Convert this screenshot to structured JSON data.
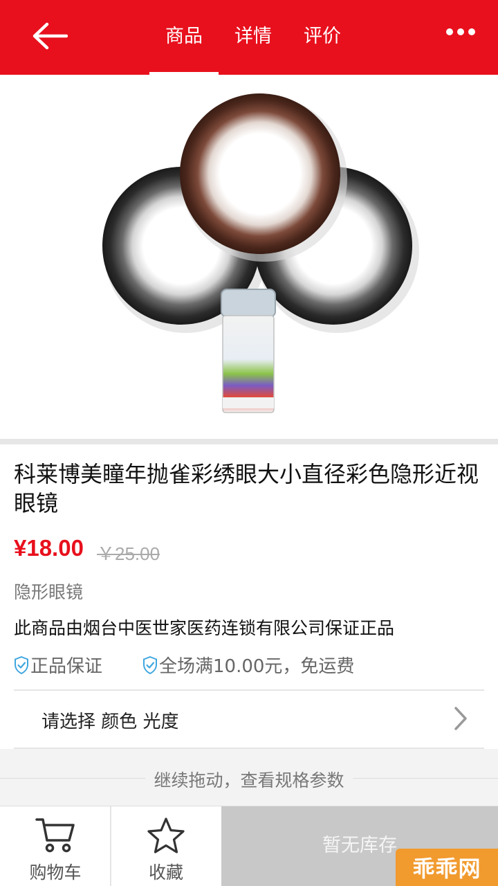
{
  "header": {
    "back_icon": "arrow-left-icon",
    "tabs": [
      {
        "label": "商品",
        "active": true
      },
      {
        "label": "详情",
        "active": false
      },
      {
        "label": "评价",
        "active": false
      }
    ],
    "more_icon": "more-dots-icon",
    "background_color": "#e8101d"
  },
  "product": {
    "image_alt": "contact-lens-product-image",
    "title": "科莱博美瞳年抛雀彩绣眼大小直径彩色隐形近视眼镜",
    "price": "¥18.00",
    "original_price": "￥25.00",
    "category": "隐形眼镜",
    "guarantee_text": "此商品由烟台中医世家医药连锁有限公司保证正品",
    "badges": [
      {
        "icon": "shield-check-icon",
        "label": "正品保证"
      },
      {
        "icon": "shield-check-icon",
        "label": "全场满10.00元，免运费"
      }
    ],
    "spec_select": "请选择 颜色 光度",
    "drag_hint": "继续拖动，查看规格参数"
  },
  "bottom_bar": {
    "cart_label": "购物车",
    "favorite_label": "收藏",
    "stock_label": "暂无库存"
  },
  "watermark": "乖乖网",
  "colors": {
    "accent": "#e8101d",
    "badge_icon": "#3ea6e0",
    "disabled": "#c8c8c8",
    "watermark": "#f19a2e"
  }
}
